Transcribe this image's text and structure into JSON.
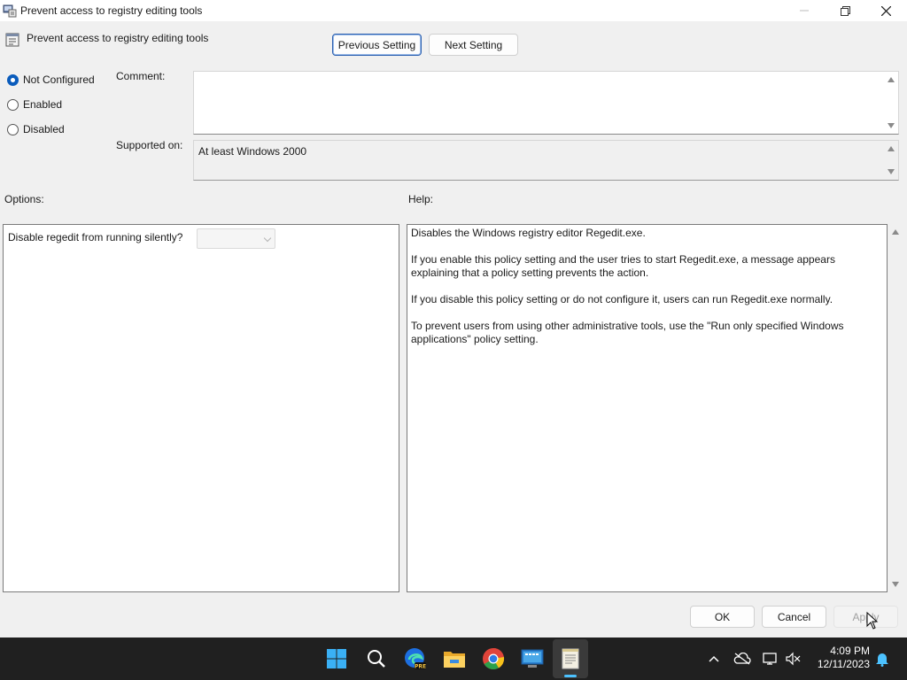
{
  "window": {
    "title": "Prevent access to registry editing tools"
  },
  "header": {
    "policy_name": "Prevent access to registry editing tools",
    "previous_label": "Previous Setting",
    "next_label": "Next Setting"
  },
  "state": {
    "options": [
      {
        "label": "Not Configured",
        "checked": true
      },
      {
        "label": "Enabled",
        "checked": false
      },
      {
        "label": "Disabled",
        "checked": false
      }
    ]
  },
  "comment": {
    "label": "Comment:",
    "value": ""
  },
  "supported": {
    "label": "Supported on:",
    "value": "At least Windows 2000"
  },
  "options_section": {
    "label": "Options:",
    "setting_label": "Disable regedit from running silently?",
    "setting_value": ""
  },
  "help_section": {
    "label": "Help:",
    "paragraphs": [
      "Disables the Windows registry editor Regedit.exe.",
      "If you enable this policy setting and the user tries to start Regedit.exe, a message appears explaining that a policy setting prevents the action.",
      "If you disable this policy setting or do not configure it, users can run Regedit.exe normally.",
      "To prevent users from using other administrative tools, use the \"Run only specified Windows applications\" policy setting."
    ]
  },
  "footer": {
    "ok_label": "OK",
    "cancel_label": "Cancel",
    "apply_label": "Apply"
  },
  "taskbar": {
    "time": "4:09 PM",
    "date": "12/11/2023",
    "icons": [
      "start-icon",
      "search-icon",
      "edge-beta-icon",
      "file-explorer-icon",
      "chrome-icon",
      "network-app-icon",
      "notepad-icon"
    ]
  },
  "colors": {
    "accent": "#0b5cbc",
    "taskbar": "#202020",
    "active_indicator": "#4cc2ff"
  }
}
